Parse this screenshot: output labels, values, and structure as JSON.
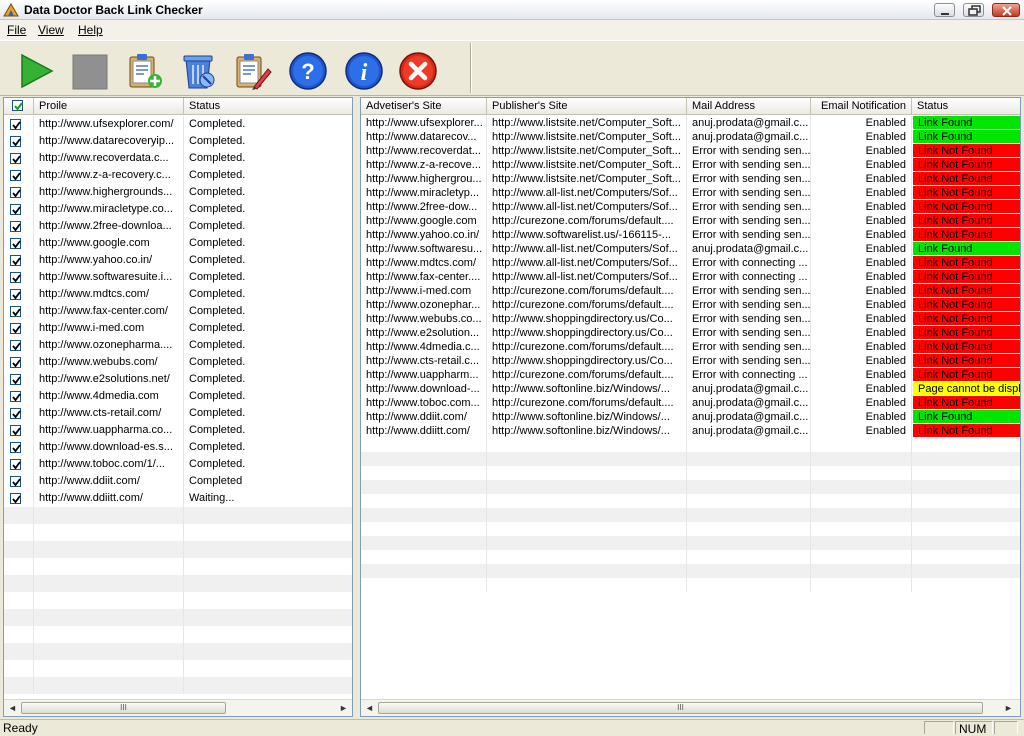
{
  "window": {
    "title": "Data Doctor Back Link Checker"
  },
  "menu": {
    "file": "File",
    "view": "View",
    "help": "Help"
  },
  "left": {
    "headers": [
      "Proile",
      "Status"
    ],
    "rows": [
      {
        "profile": "http://www.ufsexplorer.com/",
        "status": "Completed."
      },
      {
        "profile": "http://www.datarecoveryip...",
        "status": "Completed."
      },
      {
        "profile": "http://www.recoverdata.c...",
        "status": "Completed."
      },
      {
        "profile": "http://www.z-a-recovery.c...",
        "status": "Completed."
      },
      {
        "profile": "http://www.highergrounds...",
        "status": "Completed."
      },
      {
        "profile": "http://www.miracletype.co...",
        "status": "Completed."
      },
      {
        "profile": "http://www.2free-downloa...",
        "status": "Completed."
      },
      {
        "profile": "http://www.google.com",
        "status": "Completed."
      },
      {
        "profile": "http://www.yahoo.co.in/",
        "status": "Completed."
      },
      {
        "profile": "http://www.softwaresuite.i...",
        "status": "Completed."
      },
      {
        "profile": "http://www.mdtcs.com/",
        "status": "Completed."
      },
      {
        "profile": "http://www.fax-center.com/",
        "status": "Completed."
      },
      {
        "profile": "http://www.i-med.com",
        "status": "Completed."
      },
      {
        "profile": "http://www.ozonepharma....",
        "status": "Completed."
      },
      {
        "profile": "http://www.webubs.com/",
        "status": "Completed."
      },
      {
        "profile": "http://www.e2solutions.net/",
        "status": "Completed."
      },
      {
        "profile": "http://www.4dmedia.com",
        "status": "Completed."
      },
      {
        "profile": "http://www.cts-retail.com/",
        "status": "Completed."
      },
      {
        "profile": "http://www.uappharma.co...",
        "status": "Completed."
      },
      {
        "profile": "http://www.download-es.s...",
        "status": "Completed."
      },
      {
        "profile": "http://www.toboc.com/1/...",
        "status": "Completed."
      },
      {
        "profile": "http://www.ddiit.com/",
        "status": "Completed"
      },
      {
        "profile": "http://www.ddiitt.com/",
        "status": "Waiting..."
      }
    ]
  },
  "right": {
    "headers": [
      "Advetiser's Site",
      "Publisher's Site",
      "Mail Address",
      "Email Notification",
      "Status"
    ],
    "rows": [
      {
        "adv": "http://www.ufsexplorer...",
        "pub": "http://www.listsite.net/Computer_Soft...",
        "mail": "anuj.prodata@gmail.c...",
        "notif": "Enabled",
        "status": "Link Found",
        "color": "green"
      },
      {
        "adv": "http://www.datarecov...",
        "pub": "http://www.listsite.net/Computer_Soft...",
        "mail": "anuj.prodata@gmail.c...",
        "notif": "Enabled",
        "status": "Link Found",
        "color": "green"
      },
      {
        "adv": "http://www.recoverdat...",
        "pub": "http://www.listsite.net/Computer_Soft...",
        "mail": "Error with sending sen...",
        "notif": "Enabled",
        "status": "Link Not Found",
        "color": "red"
      },
      {
        "adv": "http://www.z-a-recove...",
        "pub": "http://www.listsite.net/Computer_Soft...",
        "mail": "Error with sending sen...",
        "notif": "Enabled",
        "status": "Link Not Found",
        "color": "red"
      },
      {
        "adv": "http://www.highergrou...",
        "pub": "http://www.listsite.net/Computer_Soft...",
        "mail": "Error with sending sen...",
        "notif": "Enabled",
        "status": "Link Not Found",
        "color": "red"
      },
      {
        "adv": "http://www.miracletyp...",
        "pub": "http://www.all-list.net/Computers/Sof...",
        "mail": "Error with sending sen...",
        "notif": "Enabled",
        "status": "Link Not Found",
        "color": "red"
      },
      {
        "adv": "http://www.2free-dow...",
        "pub": "http://www.all-list.net/Computers/Sof...",
        "mail": "Error with sending sen...",
        "notif": "Enabled",
        "status": "Link Not Found",
        "color": "red"
      },
      {
        "adv": "http://www.google.com",
        "pub": "http://curezone.com/forums/default....",
        "mail": "Error with sending sen...",
        "notif": "Enabled",
        "status": "Link Not Found",
        "color": "red"
      },
      {
        "adv": "http://www.yahoo.co.in/",
        "pub": "http://www.softwarelist.us/-166115-...",
        "mail": "Error with sending sen...",
        "notif": "Enabled",
        "status": "Link Not Found",
        "color": "red"
      },
      {
        "adv": "http://www.softwaresu...",
        "pub": "http://www.all-list.net/Computers/Sof...",
        "mail": "anuj.prodata@gmail.c...",
        "notif": "Enabled",
        "status": "Link Found",
        "color": "green"
      },
      {
        "adv": "http://www.mdtcs.com/",
        "pub": "http://www.all-list.net/Computers/Sof...",
        "mail": "Error with connecting ...",
        "notif": "Enabled",
        "status": "Link Not Found",
        "color": "red"
      },
      {
        "adv": "http://www.fax-center....",
        "pub": "http://www.all-list.net/Computers/Sof...",
        "mail": "Error with connecting ...",
        "notif": "Enabled",
        "status": "Link Not Found",
        "color": "red"
      },
      {
        "adv": "http://www.i-med.com",
        "pub": "http://curezone.com/forums/default....",
        "mail": "Error with sending sen...",
        "notif": "Enabled",
        "status": "Link Not Found",
        "color": "red"
      },
      {
        "adv": "http://www.ozonephar...",
        "pub": "http://curezone.com/forums/default....",
        "mail": "Error with sending sen...",
        "notif": "Enabled",
        "status": "Link Not Found",
        "color": "red"
      },
      {
        "adv": "http://www.webubs.co...",
        "pub": "http://www.shoppingdirectory.us/Co...",
        "mail": "Error with sending sen...",
        "notif": "Enabled",
        "status": "Link Not Found",
        "color": "red"
      },
      {
        "adv": "http://www.e2solution...",
        "pub": "http://www.shoppingdirectory.us/Co...",
        "mail": "Error with sending sen...",
        "notif": "Enabled",
        "status": "Link Not Found",
        "color": "red"
      },
      {
        "adv": "http://www.4dmedia.c...",
        "pub": "http://curezone.com/forums/default....",
        "mail": "Error with sending sen...",
        "notif": "Enabled",
        "status": "Link Not Found",
        "color": "red"
      },
      {
        "adv": "http://www.cts-retail.c...",
        "pub": "http://www.shoppingdirectory.us/Co...",
        "mail": "Error with sending sen...",
        "notif": "Enabled",
        "status": "Link Not Found",
        "color": "red"
      },
      {
        "adv": "http://www.uappharm...",
        "pub": "http://curezone.com/forums/default....",
        "mail": "Error with connecting ...",
        "notif": "Enabled",
        "status": "Link Not Found",
        "color": "red"
      },
      {
        "adv": "http://www.download-...",
        "pub": "http://www.softonline.biz/Windows/...",
        "mail": "anuj.prodata@gmail.c...",
        "notif": "Enabled",
        "status": "Page cannot be displ...",
        "color": "yellow"
      },
      {
        "adv": "http://www.toboc.com...",
        "pub": "http://curezone.com/forums/default....",
        "mail": "anuj.prodata@gmail.c...",
        "notif": "Enabled",
        "status": "Link Not Found",
        "color": "red"
      },
      {
        "adv": "http://www.ddiit.com/",
        "pub": "http://www.softonline.biz/Windows/...",
        "mail": "anuj.prodata@gmail.c...",
        "notif": "Enabled",
        "status": "Link Found",
        "color": "green"
      },
      {
        "adv": "http://www.ddiitt.com/",
        "pub": "http://www.softonline.biz/Windows/...",
        "mail": "anuj.prodata@gmail.c...",
        "notif": "Enabled",
        "status": "Link Not Found",
        "color": "red"
      }
    ]
  },
  "scroll": {
    "grip": "III",
    "left_arrow": "◄",
    "right_arrow": "►"
  },
  "statusbar": {
    "text": "Ready",
    "num": "NUM"
  },
  "colors": {
    "green": "#00e600",
    "red": "#ff0000",
    "yellow": "#ffff00"
  }
}
